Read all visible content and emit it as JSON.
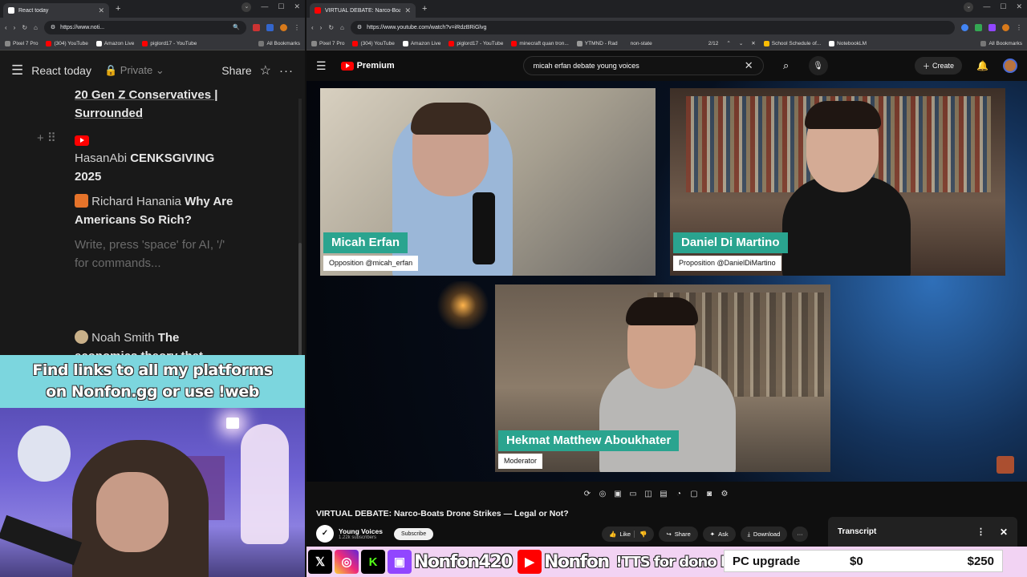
{
  "left_browser": {
    "tab_title": "React today",
    "url": "https://www.noti...",
    "bookmarks": [
      "Pixel 7 Pro",
      "(304) YouTube",
      "Amazon Live",
      "piglord17 - YouTube",
      "All Bookmarks"
    ]
  },
  "notion": {
    "page_title": "React today",
    "privacy": "Private",
    "share_label": "Share",
    "entries": [
      {
        "text": "20 Gen Z Conservatives | Surrounded"
      },
      {
        "source": "HasanAbi",
        "title": "CENKSGIVING 2025"
      },
      {
        "source": "Richard Hanania",
        "title": "Why Are Americans So Rich?"
      },
      {
        "placeholder": "Write, press 'space' for AI, '/' for commands..."
      },
      {
        "source": "Noah Smith",
        "title": "The economics theory that"
      }
    ]
  },
  "overlay_banner": {
    "line1": "Find links to all my platforms",
    "line2": "on Nonfon.gg or use !web"
  },
  "right_browser": {
    "tab_title": "VIRTUAL DEBATE: Narco-Boats",
    "url": "https://www.youtube.com/watch?v=iRdzBRiGlvg",
    "find_text": "non-state",
    "find_count": "2/12",
    "bookmarks": [
      "Pixel 7 Pro",
      "(304) YouTube",
      "Amazon Live",
      "piglord17 - YouTube",
      "minecraft quan tron...",
      "YTMND - Rad",
      "School Schedule of...",
      "NotebookLM",
      "All Bookmarks"
    ]
  },
  "youtube": {
    "logo_text": "Premium",
    "search_query": "micah erfan debate young voices",
    "create_label": "Create",
    "video_title": "VIRTUAL DEBATE: Narco-Boats Drone Strikes — Legal or Not?",
    "channel_name": "Young Voices",
    "subscribers": "1.22k subscribers",
    "subscribe_label": "Subscribe",
    "like_label": "Like",
    "share_label": "Share",
    "ask_label": "Ask",
    "download_label": "Download",
    "transcript_label": "Transcript",
    "speakers": [
      {
        "name": "Micah Erfan",
        "role": "Opposition @micah_erfan"
      },
      {
        "name": "Daniel Di Martino",
        "role": "Proposition @DanielDiMartino"
      },
      {
        "name": "Hekmat Matthew Aboukhater",
        "role": "Moderator"
      }
    ]
  },
  "stream_bar": {
    "handle1": "Nonfon420",
    "handle2": "Nonfon",
    "tts": "!TTS for dono link",
    "goal_label": "PC upgrade",
    "goal_current": "$0",
    "goal_target": "$250"
  },
  "colors": {
    "nameplate": "#2aa48f",
    "youtube_red": "#ff0000",
    "banner": "#7cd6de",
    "bottom_bar": "#f2d3f3"
  }
}
